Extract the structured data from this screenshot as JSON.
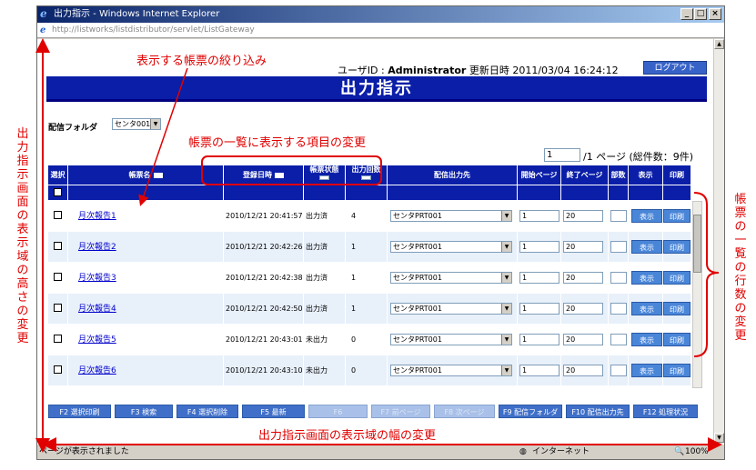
{
  "window": {
    "title": "出力指示 - Windows Internet Explorer",
    "address": "http://listworks/listdistributor/servlet/ListGateway",
    "status_text": "ページが表示されました",
    "zone": "インターネット",
    "zoom": "100%"
  },
  "header": {
    "user_label": "ユーザID",
    "user_id": "Administrator",
    "updated_label": "更新日時",
    "updated_at": "2011/03/04 16:24:12",
    "logout_label": "ログアウト",
    "title": "出力指示"
  },
  "filter": {
    "folder_label": "配信フォルダ",
    "folder_value": "センタ001"
  },
  "pagination": {
    "current_page": "1",
    "total_pages_text": "/1 ページ (総件数：9件)"
  },
  "table": {
    "columns": {
      "select": "選択",
      "name": "帳票名",
      "registered": "登録日時",
      "status": "帳票状態",
      "count": "出力回数",
      "destination": "配信出力先",
      "start_page": "開始ページ",
      "end_page": "終了ページ",
      "copies": "部数",
      "view": "表示",
      "print": "印刷"
    },
    "rows": [
      {
        "name": "月次報告1",
        "registered": "2010/12/21 20:41:57",
        "status": "出力済",
        "count": "4",
        "destination": "センタPRT001",
        "start": "1",
        "end": "20",
        "view": "表示",
        "print": "印刷"
      },
      {
        "name": "月次報告2",
        "registered": "2010/12/21 20:42:26",
        "status": "出力済",
        "count": "1",
        "destination": "センタPRT001",
        "start": "1",
        "end": "20",
        "view": "表示",
        "print": "印刷"
      },
      {
        "name": "月次報告3",
        "registered": "2010/12/21 20:42:38",
        "status": "出力済",
        "count": "1",
        "destination": "センタPRT001",
        "start": "1",
        "end": "20",
        "view": "表示",
        "print": "印刷"
      },
      {
        "name": "月次報告4",
        "registered": "2010/12/21 20:42:50",
        "status": "出力済",
        "count": "1",
        "destination": "センタPRT001",
        "start": "1",
        "end": "20",
        "view": "表示",
        "print": "印刷"
      },
      {
        "name": "月次報告5",
        "registered": "2010/12/21 20:43:01",
        "status": "未出力",
        "count": "0",
        "destination": "センタPRT001",
        "start": "1",
        "end": "20",
        "view": "表示",
        "print": "印刷"
      },
      {
        "name": "月次報告6",
        "registered": "2010/12/21 20:43:10",
        "status": "未出力",
        "count": "0",
        "destination": "センタPRT001",
        "start": "1",
        "end": "20",
        "view": "表示",
        "print": "印刷"
      }
    ]
  },
  "function_keys": [
    {
      "label": "F2 選択印刷",
      "enabled": true
    },
    {
      "label": "F3 検索",
      "enabled": true
    },
    {
      "label": "F4 選択削除",
      "enabled": true
    },
    {
      "label": "F5 最新",
      "enabled": true
    },
    {
      "label": "F6",
      "enabled": false
    },
    {
      "label": "F7 前ページ",
      "enabled": false
    },
    {
      "label": "F8 次ページ",
      "enabled": false
    },
    {
      "label": "F9 配信フォルダ",
      "enabled": true
    },
    {
      "label": "F10 配信出力先",
      "enabled": true
    },
    {
      "label": "F12 処理状況",
      "enabled": true
    }
  ],
  "annotations": {
    "filter_note": "表示する帳票の絞り込み",
    "columns_note": "帳票の一覧に表示する項目の変更",
    "height_note": "出力指示画面の表示域の高さの変更",
    "width_note": "出力指示画面の表示域の幅の変更",
    "rows_note": "帳票の一覧の行数の変更"
  },
  "colors": {
    "header_blue": "#0a1ea8",
    "button_blue": "#4a86d8",
    "annotation_red": "#e00000"
  }
}
